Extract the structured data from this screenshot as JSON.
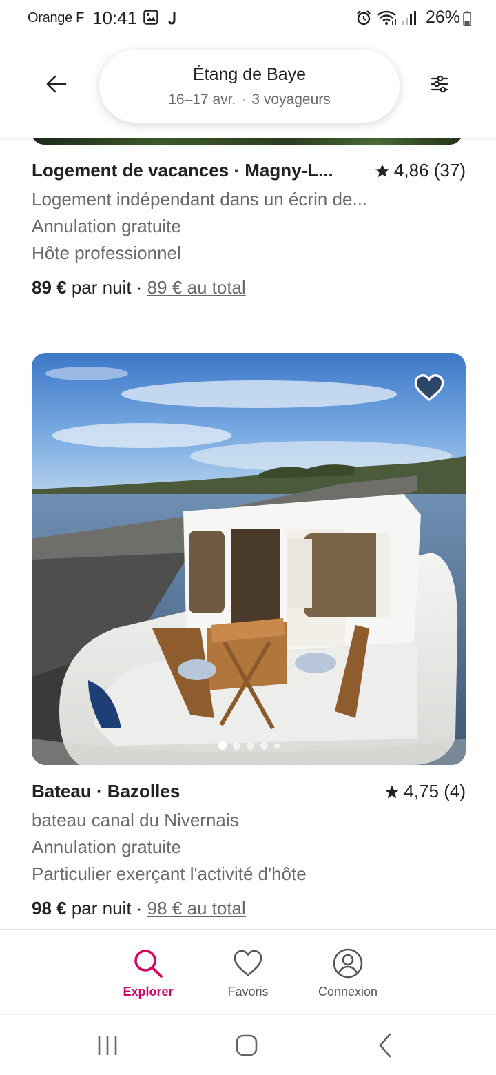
{
  "status_bar": {
    "carrier": "Orange F",
    "time": "10:41",
    "battery": "26%"
  },
  "header": {
    "title": "Étang de Baye",
    "dates": "16–17 avr.",
    "separator": "·",
    "guests": "3 voyageurs"
  },
  "listings": [
    {
      "title": "Logement de vacances · Magny-L...",
      "rating": "4,86 (37)",
      "description": "Logement indépendant dans un écrin de...",
      "cancellation": "Annulation gratuite",
      "host": "Hôte professionnel",
      "price": "89 €",
      "price_unit": " par nuit · ",
      "total": "89 € au total"
    },
    {
      "title": "Bateau · Bazolles",
      "rating": "4,75 (4)",
      "description": "bateau canal du Nivernais",
      "cancellation": "Annulation gratuite",
      "host": "Particulier exerçant l'activité d'hôte",
      "price": "98 €",
      "price_unit": " par nuit · ",
      "total": "98 € au total",
      "photo_count": 5,
      "photo_index": 1,
      "favorited": false
    }
  ],
  "bottom_nav": {
    "items": [
      {
        "label": "Explorer",
        "icon": "search-icon",
        "active": true
      },
      {
        "label": "Favoris",
        "icon": "heart-icon",
        "active": false
      },
      {
        "label": "Connexion",
        "icon": "user-circle-icon",
        "active": false
      }
    ]
  },
  "colors": {
    "accent": "#d70466",
    "text_primary": "#222222",
    "text_secondary": "#6a6a6a"
  }
}
